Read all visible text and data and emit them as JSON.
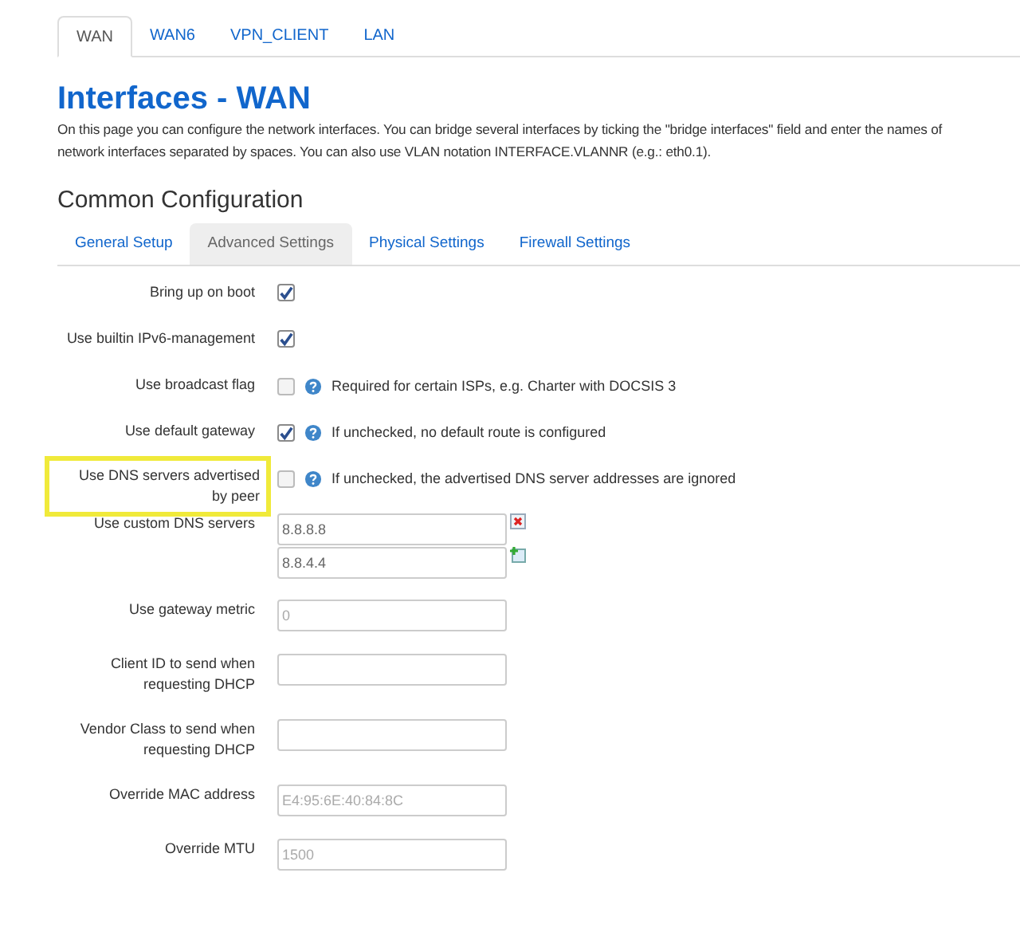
{
  "top_tabs": [
    {
      "label": "WAN",
      "selected": true
    },
    {
      "label": "WAN6",
      "selected": false
    },
    {
      "label": "VPN_CLIENT",
      "selected": false
    },
    {
      "label": "LAN",
      "selected": false
    }
  ],
  "title": "Interfaces - WAN",
  "description": [
    "On this page you can configure the network interfaces. You can bridge several interfaces by ticking the \"bridge interfaces\" field and enter the names of",
    "network interfaces separated by spaces. You can also use VLAN notation INTERFACE.VLANNR (e.g.: eth0.1)."
  ],
  "section_title": "Common Configuration",
  "section_tabs": [
    {
      "label": "General Setup",
      "selected": false
    },
    {
      "label": "Advanced Settings",
      "selected": true
    },
    {
      "label": "Physical Settings",
      "selected": false
    },
    {
      "label": "Firewall Settings",
      "selected": false
    }
  ],
  "rows": [
    {
      "kind": "checkbox",
      "label": "Bring up on boot",
      "checked": true
    },
    {
      "kind": "checkbox",
      "label": "Use builtin IPv6-management",
      "checked": true
    },
    {
      "kind": "checkbox",
      "label": "Use broadcast flag",
      "checked": false,
      "help": "Required for certain ISPs, e.g. Charter with DOCSIS 3"
    },
    {
      "kind": "checkbox",
      "label": "Use default gateway",
      "checked": true,
      "help": "If unchecked, no default route is configured"
    },
    {
      "kind": "checkbox",
      "label": "Use DNS servers advertised by peer",
      "checked": false,
      "help": "If unchecked, the advertised DNS server addresses are ignored",
      "highlighted": true
    },
    {
      "kind": "list",
      "label": "Use custom DNS servers",
      "values": [
        "8.8.8.8",
        "8.8.4.4"
      ]
    },
    {
      "kind": "text",
      "label": "Use gateway metric",
      "placeholder": "0"
    },
    {
      "kind": "text",
      "label": "Client ID to send when requesting DHCP"
    },
    {
      "kind": "text",
      "label": "Vendor Class to send when requesting DHCP"
    },
    {
      "kind": "text",
      "label": "Override MAC address",
      "placeholder": "E4:95:6E:40:84:8C"
    },
    {
      "kind": "text",
      "label": "Override MTU",
      "placeholder": "1500"
    }
  ]
}
